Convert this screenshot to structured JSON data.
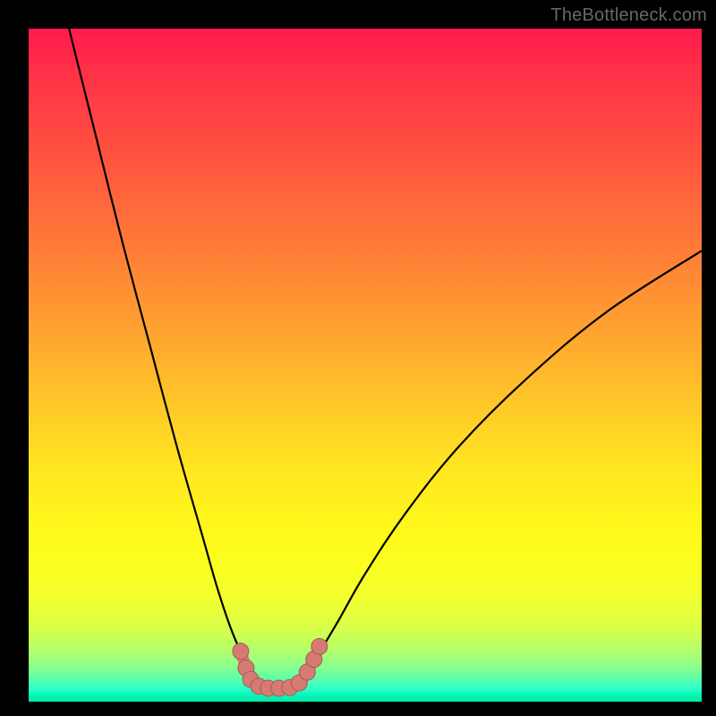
{
  "watermark": "TheBottleneck.com",
  "colors": {
    "frame": "#000000",
    "gradient_top": "#ff1a4d",
    "gradient_bottom": "#02e8a0",
    "curve_stroke": "#000000",
    "marker_fill": "#d57b74",
    "marker_stroke": "#a85a52"
  },
  "chart_data": {
    "type": "line",
    "title": "",
    "xlabel": "",
    "ylabel": "",
    "xlim": [
      0,
      100
    ],
    "ylim": [
      0,
      100
    ],
    "background": "heatmap-gradient (red=high bottleneck, green=low bottleneck)",
    "series": [
      {
        "name": "left-branch",
        "x": [
          6,
          10,
          14,
          18,
          22,
          26,
          28,
          30,
          31.5,
          33,
          35,
          37
        ],
        "y": [
          100,
          84,
          68,
          53,
          38,
          24,
          17,
          11,
          7.5,
          5,
          2.5,
          2
        ]
      },
      {
        "name": "right-branch",
        "x": [
          37,
          39,
          41,
          43,
          46,
          50,
          56,
          64,
          74,
          86,
          100
        ],
        "y": [
          2,
          2.5,
          4,
          7,
          12,
          19,
          28,
          38,
          48,
          58,
          67
        ]
      }
    ],
    "markers": {
      "name": "highlighted-band",
      "comment": "coral connected dots near the trough",
      "points": [
        {
          "x": 31.5,
          "y": 7.5
        },
        {
          "x": 32.3,
          "y": 5.0
        },
        {
          "x": 33.0,
          "y": 3.3
        },
        {
          "x": 34.2,
          "y": 2.3
        },
        {
          "x": 35.6,
          "y": 2.0
        },
        {
          "x": 37.2,
          "y": 2.0
        },
        {
          "x": 38.8,
          "y": 2.1
        },
        {
          "x": 40.2,
          "y": 2.8
        },
        {
          "x": 41.4,
          "y": 4.4
        },
        {
          "x": 42.4,
          "y": 6.3
        },
        {
          "x": 43.2,
          "y": 8.2
        }
      ]
    }
  }
}
